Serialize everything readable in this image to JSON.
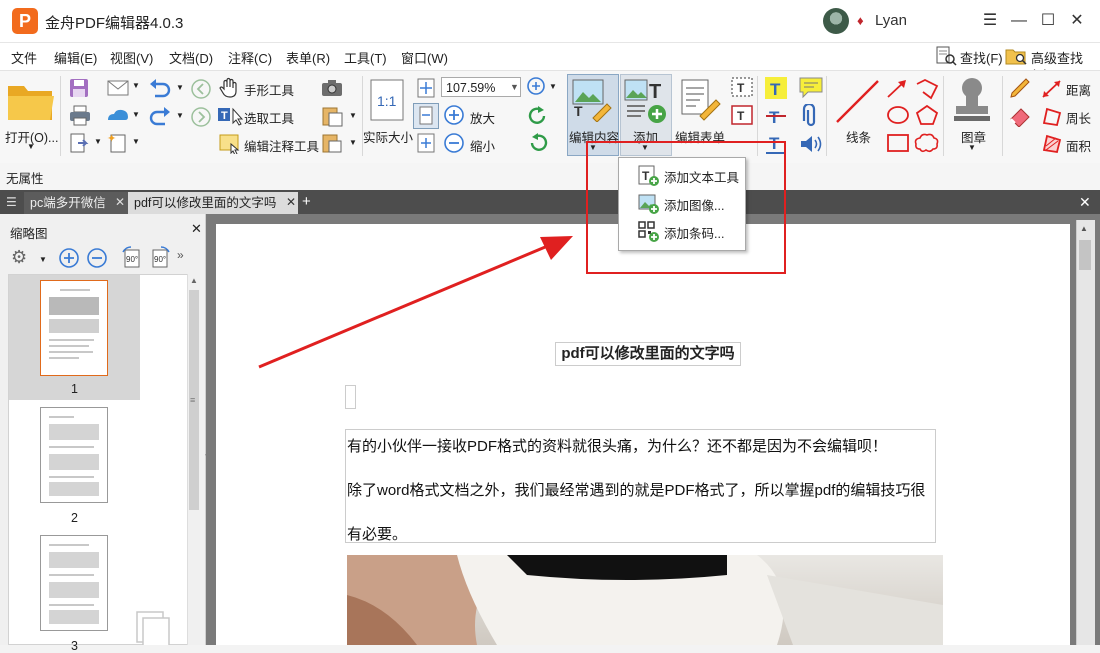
{
  "app": {
    "title": "金舟PDF编辑器4.0.3",
    "logo_letter": "P",
    "user": "Lyan"
  },
  "menu": [
    "文件",
    "编辑(E)",
    "视图(V)",
    "文档(D)",
    "注释(C)",
    "表单(R)",
    "工具(T)",
    "窗口(W)"
  ],
  "search": {
    "find": "查找(F)",
    "advanced": "高级查找(S)"
  },
  "toolbar": {
    "open": "打开(O)...",
    "hand": "手形工具",
    "select": "选取工具",
    "edit_annot": "编辑注释工具",
    "actual_size": "实际大小",
    "zoom_value": "107.59%",
    "zoom_in": "放大",
    "zoom_out": "缩小",
    "edit_content": "编辑内容",
    "add": "添加",
    "edit_form": "编辑表单",
    "lines": "线条",
    "stamp": "图章",
    "distance": "距离",
    "perimeter": "周长",
    "area": "面积"
  },
  "properties": "无属性",
  "tabs": [
    {
      "label": "pc端多开微信",
      "active": false
    },
    {
      "label": "pdf可以修改里面的文字吗",
      "active": true
    }
  ],
  "sidebar": {
    "title": "缩略图",
    "pages": [
      "1",
      "2",
      "3"
    ]
  },
  "dropdown": [
    {
      "label": "添加文本工具",
      "icon": "add-text-icon"
    },
    {
      "label": "添加图像...",
      "icon": "add-image-icon"
    },
    {
      "label": "添加条码...",
      "icon": "add-barcode-icon"
    }
  ],
  "document": {
    "title": "pdf可以修改里面的文字吗",
    "line1": "有的小伙伴一接收PDF格式的资料就很头痛，为什么？还不都是因为不会编辑呗！",
    "line2": "除了word格式文档之外，我们最经常遇到的就是PDF格式了，所以掌握pdf的编辑技巧很",
    "line3": "有必要。"
  },
  "colors": {
    "highlight_red": "#e02020",
    "brand_orange": "#f26b1d",
    "tabbar": "#4d4d4d"
  }
}
